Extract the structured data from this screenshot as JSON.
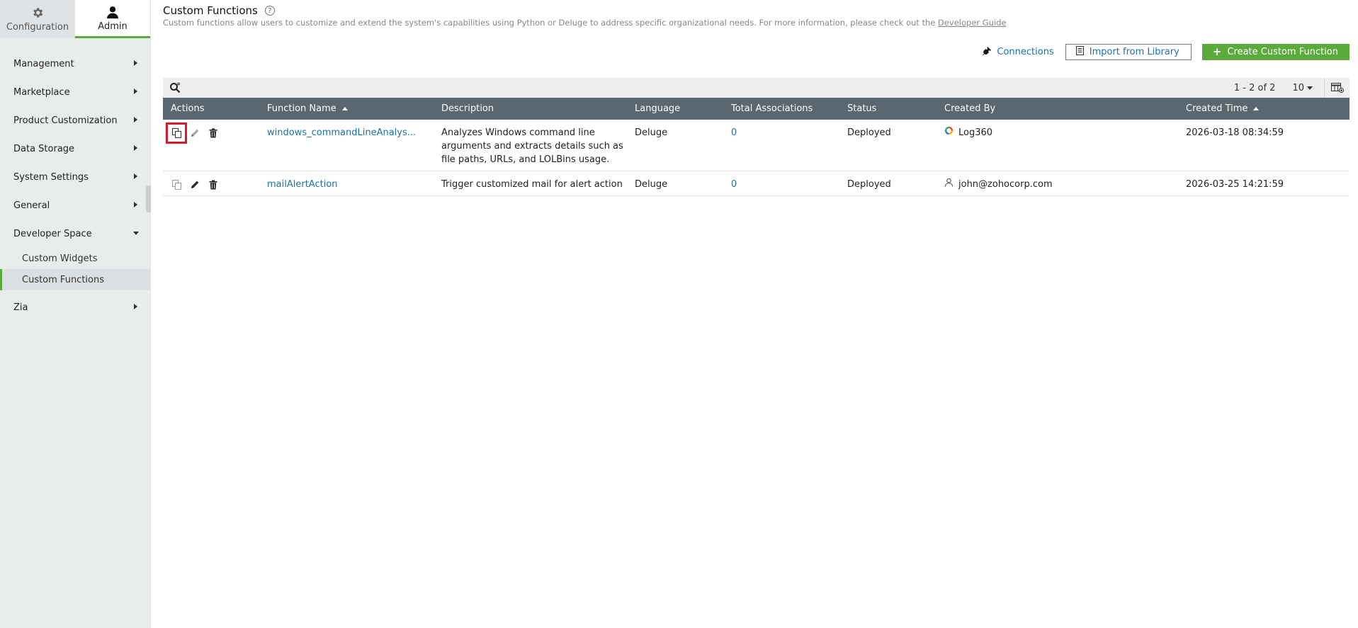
{
  "topnav": {
    "configuration_label": "Configuration",
    "admin_label": "Admin"
  },
  "sidebar": {
    "items": [
      {
        "label": "Management"
      },
      {
        "label": "Marketplace"
      },
      {
        "label": "Product Customization"
      },
      {
        "label": "Data Storage"
      },
      {
        "label": "System Settings"
      },
      {
        "label": "General"
      },
      {
        "label": "Developer Space"
      },
      {
        "label": "Zia"
      }
    ],
    "developer_sub": [
      {
        "label": "Custom Widgets"
      },
      {
        "label": "Custom Functions"
      }
    ]
  },
  "header": {
    "title": "Custom Functions",
    "help_glyph": "?",
    "subtitle": "Custom functions allow users to customize and extend the system's capabilities using Python or Deluge to address specific organizational needs. For more information, please check out the ",
    "guide_link": "Developer Guide"
  },
  "actions": {
    "connections_label": "Connections",
    "import_label": "Import from Library",
    "create_label": "Create Custom Function"
  },
  "toolbar": {
    "pager": "1 - 2 of 2",
    "per_page": "10"
  },
  "table": {
    "columns": {
      "actions": "Actions",
      "function_name": "Function Name",
      "description": "Description",
      "language": "Language",
      "total_associations": "Total Associations",
      "status": "Status",
      "created_by": "Created By",
      "created_time": "Created Time"
    },
    "rows": [
      {
        "function_name": "windows_commandLineAnalys...",
        "description": "Analyzes Windows command line arguments and extracts details such as file paths, URLs, and LOLBins usage.",
        "language": "Deluge",
        "total_associations": "0",
        "status": "Deployed",
        "created_by": "Log360",
        "created_time": "2026-03-18 08:34:59"
      },
      {
        "function_name": "mailAlertAction",
        "description": "Trigger customized mail for alert action",
        "language": "Deluge",
        "total_associations": "0",
        "status": "Deployed",
        "created_by": "john@zohocorp.com",
        "created_time": "2026-03-25 14:21:59"
      }
    ]
  },
  "colors": {
    "accent_green": "#5aab3c",
    "link_blue": "#1a73a8",
    "table_header": "#5a6670",
    "highlight_red": "#d41f2a"
  },
  "icons": [
    "gear-icon",
    "user-icon",
    "help-icon",
    "plug-icon",
    "document-icon",
    "plus-icon",
    "search-icon",
    "caret-down-icon",
    "column-chooser-icon",
    "copy-icon",
    "edit-icon",
    "delete-icon",
    "log360-logo-icon",
    "person-icon"
  ]
}
